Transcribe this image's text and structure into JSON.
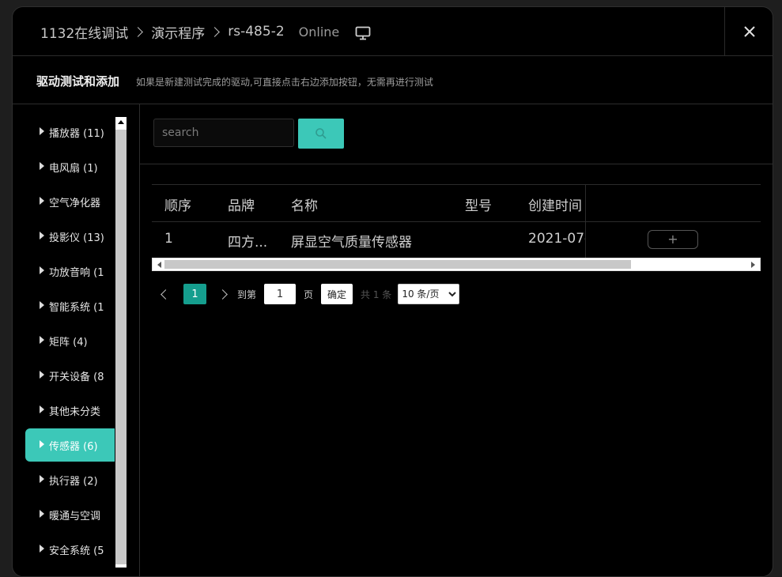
{
  "header": {
    "breadcrumb": [
      "1132在线调试",
      "演示程序",
      "rs-485-2"
    ],
    "status": "Online"
  },
  "subheader": {
    "title": "驱动测试和添加",
    "description": "如果是新建测试完成的驱动,可直接点击右边添加按钮，无需再进行测试"
  },
  "sidebar": {
    "items": [
      {
        "label": "播放器 (11)"
      },
      {
        "label": "电风扇 (1)"
      },
      {
        "label": "空气净化器"
      },
      {
        "label": "投影仪 (13)"
      },
      {
        "label": "功放音响 (1"
      },
      {
        "label": "智能系统 (1"
      },
      {
        "label": "矩阵 (4)"
      },
      {
        "label": "开关设备 (8"
      },
      {
        "label": "其他未分类"
      },
      {
        "label": "传感器 (6)",
        "active": true
      },
      {
        "label": "执行器 (2)"
      },
      {
        "label": "暖通与空调"
      },
      {
        "label": "安全系统 (5"
      }
    ]
  },
  "search": {
    "placeholder": "search"
  },
  "table": {
    "headers": [
      "顺序",
      "品牌",
      "名称",
      "型号",
      "创建时间"
    ],
    "rows": [
      {
        "index": "1",
        "brand": "四方...",
        "name": "屏显空气质量传感器",
        "model": "",
        "created": "2021-07-",
        "action": "+"
      }
    ]
  },
  "pagination": {
    "current_page": "1",
    "goto_label": "到第",
    "goto_value": "1",
    "page_unit": "页",
    "confirm_label": "确定",
    "total_label": "共 1 条",
    "page_size": "10 条/页",
    "page_size_options": [
      "10 条/页"
    ]
  },
  "colors": {
    "accent": "#3cc8b8",
    "accent_dark": "#159e8e",
    "background": "#000000"
  }
}
